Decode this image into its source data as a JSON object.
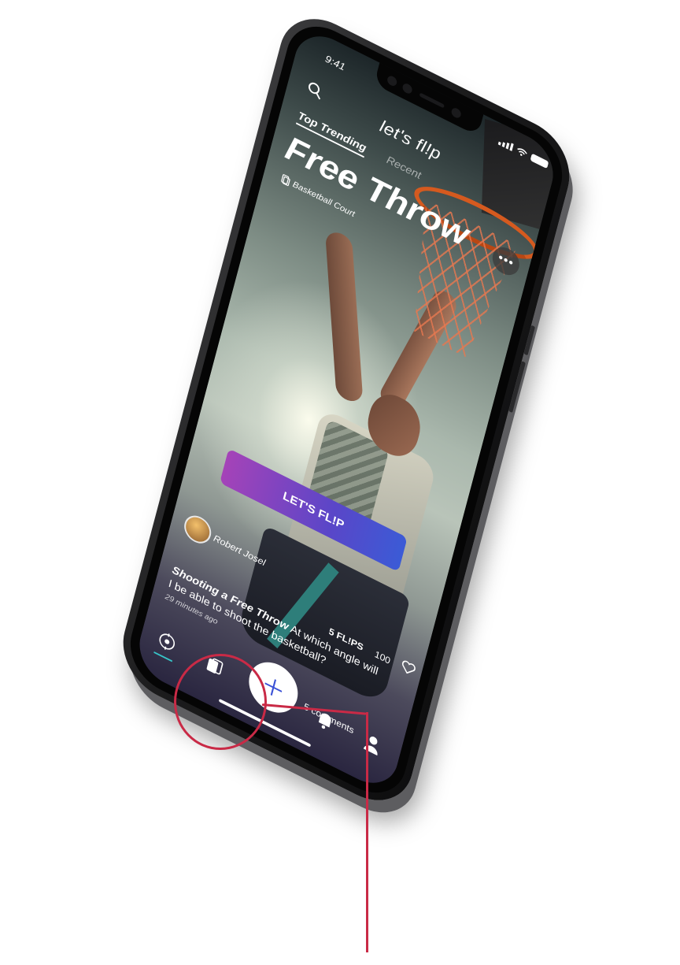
{
  "status_bar": {
    "time": "9:41"
  },
  "app": {
    "logo": "let's fl!p"
  },
  "tabs": [
    {
      "label": "Top Trending",
      "active": true
    },
    {
      "label": "Recent",
      "active": false
    }
  ],
  "card": {
    "title": "Free Throw",
    "location": "Basketball Court",
    "cta_label": "LET'S FL!P"
  },
  "post": {
    "author": "Robert Josel",
    "title": "Shooting a Free Throw",
    "body": "At which angle will I be able to shoot the basketball?",
    "time_ago": "29 minutes ago",
    "flips": "5 FL!PS",
    "likes": "100",
    "comments": "5 comments"
  },
  "colors": {
    "accent": "#c92a46",
    "cta_start": "#a543b8",
    "cta_end": "#3b5bd6",
    "nav_active": "#37c4c8"
  },
  "icons": [
    "search-icon",
    "more-icon",
    "location-icon",
    "heart-icon",
    "explore-icon",
    "cards-icon",
    "plus-icon",
    "bell-icon",
    "profile-icon"
  ]
}
